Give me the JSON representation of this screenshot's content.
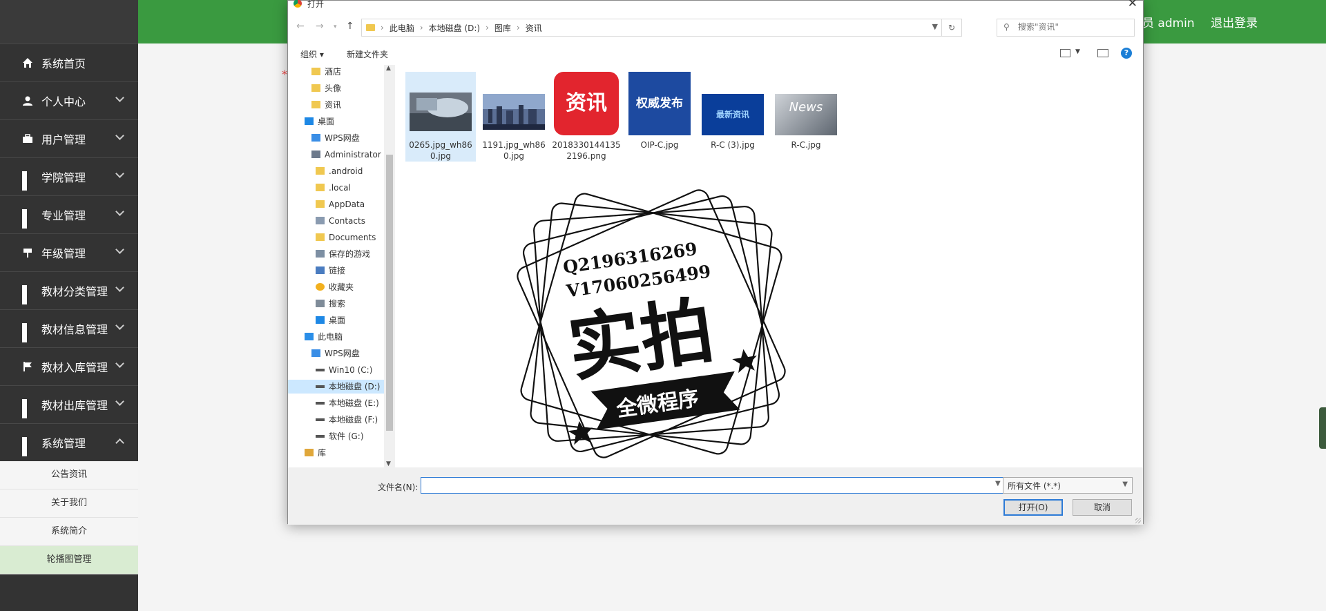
{
  "topbar": {
    "user_text": "员 admin",
    "logout": "退出登录"
  },
  "sidebar": {
    "items": [
      {
        "label": "系统首页",
        "icon": "home-icon"
      },
      {
        "label": "个人中心",
        "icon": "user-icon"
      },
      {
        "label": "用户管理",
        "icon": "briefcase-icon"
      },
      {
        "label": "学院管理",
        "icon": "grid-icon"
      },
      {
        "label": "专业管理",
        "icon": "grid-icon"
      },
      {
        "label": "年级管理",
        "icon": "tag-icon"
      },
      {
        "label": "教材分类管理",
        "icon": "grid-icon"
      },
      {
        "label": "教材信息管理",
        "icon": "grid-icon"
      },
      {
        "label": "教材入库管理",
        "icon": "flag-icon"
      },
      {
        "label": "教材出库管理",
        "icon": "grid-icon"
      },
      {
        "label": "系统管理",
        "icon": "grid-icon"
      }
    ],
    "subitems": [
      "公告资讯",
      "关于我们",
      "系统简介",
      "轮播图管理"
    ]
  },
  "dialog": {
    "title": "打开",
    "breadcrumb": [
      "此电脑",
      "本地磁盘 (D:)",
      "图库",
      "资讯"
    ],
    "search_placeholder": "搜索\"资讯\"",
    "toolbar": {
      "organize": "组织 ▾",
      "new_folder": "新建文件夹"
    },
    "tree": [
      "酒店",
      "头像",
      "资讯",
      "桌面",
      "WPS网盘",
      "Administrator",
      ".android",
      ".local",
      "AppData",
      "Contacts",
      "Documents",
      "保存的游戏",
      "链接",
      "收藏夹",
      "搜索",
      "桌面",
      "此电脑",
      "WPS网盘",
      "Win10 (C:)",
      "本地磁盘 (D:)",
      "本地磁盘 (E:)",
      "本地磁盘 (F:)",
      "软件 (G:)",
      "库"
    ],
    "files": [
      {
        "name": "0265.jpg_wh860.jpg"
      },
      {
        "name": "1191.jpg_wh860.jpg"
      },
      {
        "name": "20183301441352196.png",
        "thumb_text": "资讯"
      },
      {
        "name": "OIP-C.jpg",
        "thumb_text": "权威发布"
      },
      {
        "name": "R-C (3).jpg",
        "thumb_text": "最新资讯"
      },
      {
        "name": "R-C.jpg",
        "thumb_text": "News"
      }
    ],
    "filename_label": "文件名(N):",
    "filename_value": "",
    "filter": "所有文件 (*.*)",
    "open_button": "打开(O)",
    "cancel_button": "取消"
  },
  "watermark": {
    "line1": "Q2196316269",
    "line2": "V17060256499",
    "main": "实拍",
    "ribbon": "全微程序"
  },
  "colors": {
    "topbar": "#3a9a40",
    "sidebar": "#333333",
    "accent_blue": "#2c7ad6",
    "submenu_active": "#d9ecd2"
  }
}
